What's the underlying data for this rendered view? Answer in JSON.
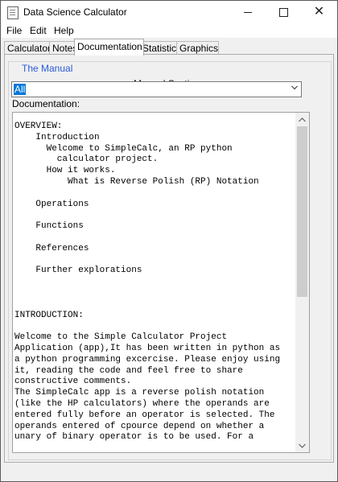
{
  "window": {
    "title": "Data Science Calculator",
    "icon": "app-icon",
    "controls": {
      "minimize_icon": "minimize-icon",
      "maximize_icon": "maximize-icon",
      "close_icon": "close-icon",
      "close_glyph": "✕"
    }
  },
  "menu": [
    "File",
    "Edit",
    "Help"
  ],
  "tabs": [
    {
      "label": "Calculator",
      "active": false
    },
    {
      "label": "Notes",
      "active": false
    },
    {
      "label": "Documentation",
      "active": true
    },
    {
      "label": "Statistics",
      "active": false
    },
    {
      "label": "Graphics",
      "active": false
    }
  ],
  "panel": {
    "group_title": "The Manual",
    "sections_label": "Manual Sections:",
    "sections_value": "All",
    "doc_label": "Documentation:",
    "doc_text": "OVERVIEW:\n    Introduction\n      Welcome to SimpleCalc, an RP python\n        calculator project.\n      How it works.\n          What is Reverse Polish (RP) Notation\n\n    Operations\n\n    Functions\n\n    References\n\n    Further explorations\n\n\n\nINTRODUCTION:\n\nWelcome to the Simple Calculator Project\nApplication (app),It has been written in python as\na python programming excercise. Please enjoy using\nit, reading the code and feel free to share\nconstructive comments.\nThe SimpleCalc app is a reverse polish notation\n(like the HP calculators) where the operands are\nentered fully before an operator is selected. The\noperands entered of cpource depend on whether a\nunary of binary operator is to be used. For a",
    "scroll_position": 0.0
  },
  "colors": {
    "group_title": "#2a5ad8",
    "selection": "#0078d7"
  }
}
